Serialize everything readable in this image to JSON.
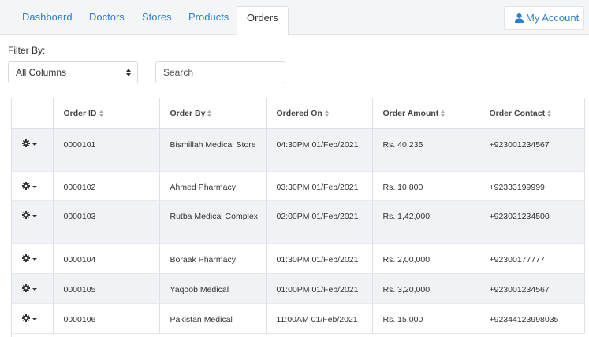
{
  "nav": {
    "tabs": [
      {
        "label": "Dashboard",
        "active": false
      },
      {
        "label": "Doctors",
        "active": false
      },
      {
        "label": "Stores",
        "active": false
      },
      {
        "label": "Products",
        "active": false
      },
      {
        "label": "Orders",
        "active": true
      }
    ],
    "account_label": "My Account",
    "account_icon": "user-icon"
  },
  "filter": {
    "label": "Filter By:",
    "select_value": "All Columns",
    "search_placeholder": "Search"
  },
  "table": {
    "columns": [
      "",
      "Order ID",
      "Order By",
      "Ordered On",
      "Order Amount",
      "Order Contact"
    ],
    "rows": [
      {
        "order_id": "0000101",
        "order_by": "Bismillah Medical Store",
        "ordered_on": "04:30PM 01/Feb/2021",
        "amount": "Rs. 40,235",
        "contact": "+923001234567"
      },
      {
        "order_id": "0000102",
        "order_by": "Ahmed Pharmacy",
        "ordered_on": "03:30PM 01/Feb/2021",
        "amount": "Rs. 10,800",
        "contact": "+92333199999"
      },
      {
        "order_id": "0000103",
        "order_by": "Rutba Medical Complex",
        "ordered_on": "02:00PM 01/Feb/2021",
        "amount": "Rs. 1,42,000",
        "contact": "+923021234500"
      },
      {
        "order_id": "0000104",
        "order_by": "Boraak Pharmacy",
        "ordered_on": "01:30PM 01/Feb/2021",
        "amount": "Rs. 2,00,000",
        "contact": "+92300177777"
      },
      {
        "order_id": "0000105",
        "order_by": "Yaqoob Medical",
        "ordered_on": "01:00PM 01/Feb/2021",
        "amount": "Rs. 3,20,000",
        "contact": "+923001234567"
      },
      {
        "order_id": "0000106",
        "order_by": "Pakistan Medical",
        "ordered_on": "11:00AM 01/Feb/2021",
        "amount": "Rs. 15,000",
        "contact": "+92344123998035"
      }
    ]
  },
  "colors": {
    "link": "#2a7fd4",
    "stripe": "#f0f2f5",
    "nav_bg": "#f4f5f7"
  }
}
